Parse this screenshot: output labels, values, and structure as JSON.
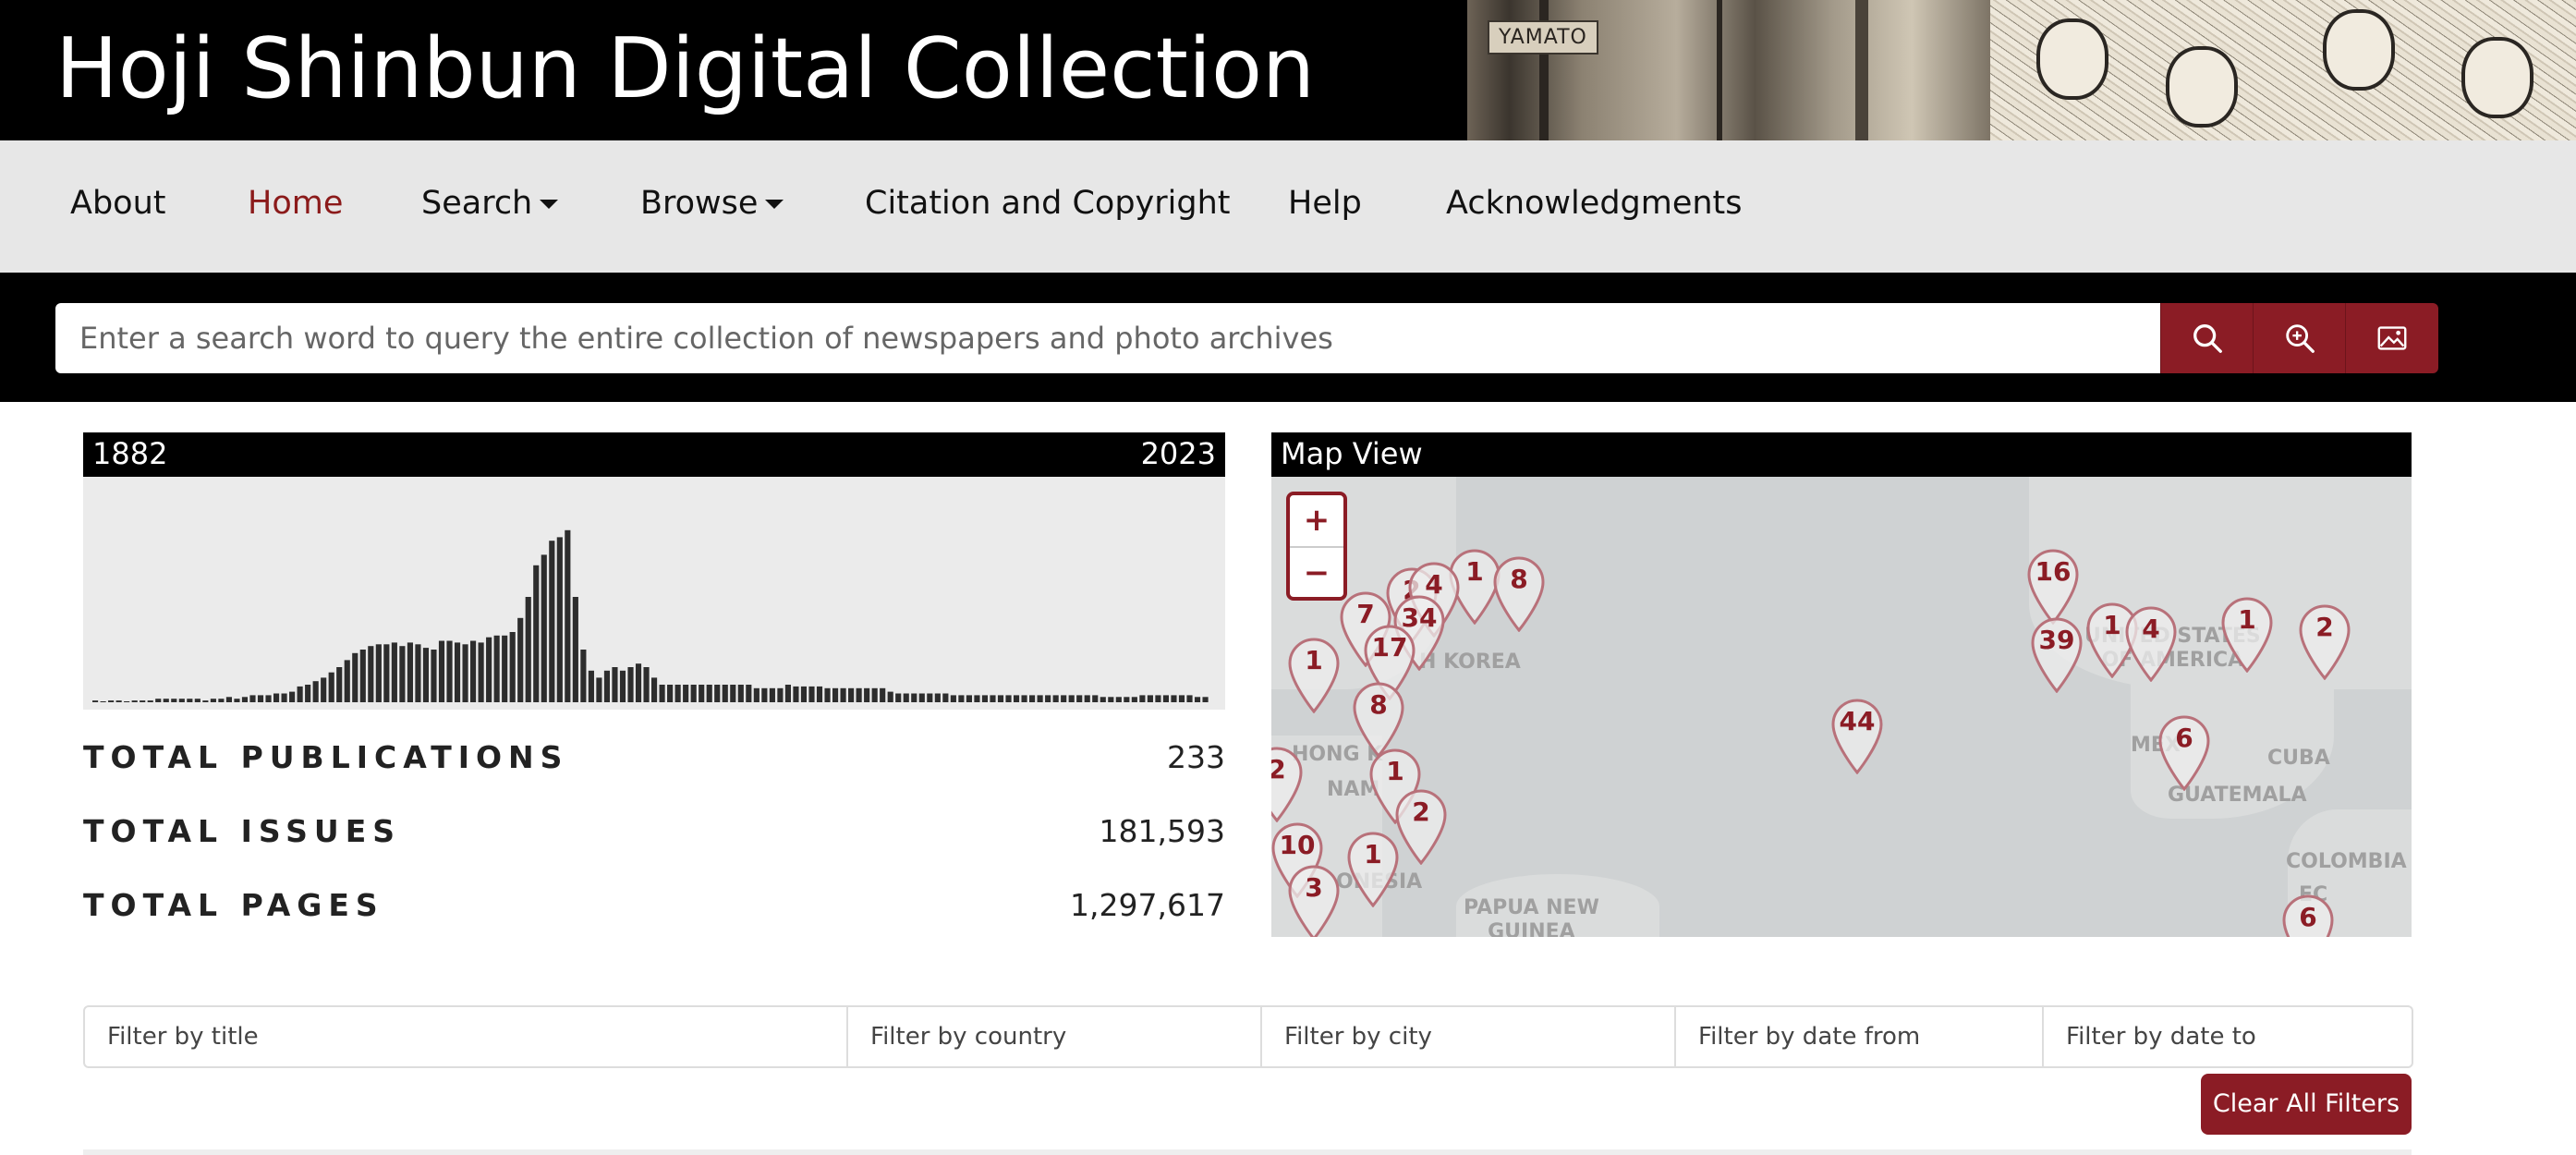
{
  "header": {
    "title": "Hoji Shinbun Digital Collection",
    "banner_sign": "YAMATO"
  },
  "nav": {
    "items": [
      {
        "label": "About"
      },
      {
        "label": "Home",
        "active": true
      },
      {
        "label": "Search",
        "dropdown": true
      },
      {
        "label": "Browse",
        "dropdown": true
      },
      {
        "label": "Citation and Copyright"
      },
      {
        "label": "Help"
      },
      {
        "label": "Acknowledgments"
      }
    ]
  },
  "search": {
    "placeholder": "Enter a search word to query the entire collection of newspapers and photo archives",
    "buttons": [
      "search-icon",
      "zoom-in-search-icon",
      "image-icon"
    ]
  },
  "timeline": {
    "start": "1882",
    "end": "2023",
    "bar_count": 142,
    "histogram_levels": [
      0.01,
      0.0,
      0.01,
      0.01,
      0.0,
      0.01,
      0.01,
      0.01,
      0.02,
      0.02,
      0.02,
      0.02,
      0.02,
      0.02,
      0.01,
      0.02,
      0.02,
      0.03,
      0.02,
      0.03,
      0.04,
      0.04,
      0.04,
      0.05,
      0.05,
      0.06,
      0.09,
      0.1,
      0.12,
      0.14,
      0.17,
      0.2,
      0.24,
      0.28,
      0.3,
      0.32,
      0.33,
      0.33,
      0.34,
      0.32,
      0.34,
      0.33,
      0.31,
      0.3,
      0.35,
      0.35,
      0.34,
      0.33,
      0.35,
      0.34,
      0.37,
      0.38,
      0.38,
      0.4,
      0.48,
      0.6,
      0.78,
      0.84,
      0.92,
      0.94,
      0.98,
      0.6,
      0.3,
      0.18,
      0.14,
      0.18,
      0.2,
      0.18,
      0.2,
      0.22,
      0.2,
      0.14,
      0.1,
      0.1,
      0.1,
      0.1,
      0.1,
      0.1,
      0.1,
      0.1,
      0.1,
      0.1,
      0.1,
      0.1,
      0.08,
      0.08,
      0.08,
      0.08,
      0.1,
      0.09,
      0.09,
      0.09,
      0.09,
      0.08,
      0.08,
      0.08,
      0.08,
      0.08,
      0.08,
      0.08,
      0.08,
      0.06,
      0.05,
      0.05,
      0.05,
      0.05,
      0.05,
      0.05,
      0.05,
      0.04,
      0.04,
      0.04,
      0.04,
      0.04,
      0.04,
      0.04,
      0.04,
      0.04,
      0.04,
      0.04,
      0.04,
      0.04,
      0.04,
      0.04,
      0.04,
      0.04,
      0.04,
      0.04,
      0.03,
      0.03,
      0.03,
      0.03,
      0.03,
      0.04,
      0.04,
      0.04,
      0.04,
      0.04,
      0.04,
      0.04,
      0.03,
      0.03
    ]
  },
  "stats": [
    {
      "label": "TOTAL PUBLICATIONS",
      "value": "233"
    },
    {
      "label": "TOTAL ISSUES",
      "value": "181,593"
    },
    {
      "label": "TOTAL PAGES",
      "value": "1,297,617"
    }
  ],
  "map": {
    "title": "Map View",
    "zoom_in": "+",
    "zoom_out": "−",
    "labels": [
      {
        "text": "UNITED STATES\nOF AMERICA"
      },
      {
        "text": "CUBA"
      },
      {
        "text": "GUATEMALA"
      },
      {
        "text": "COLOMBIA"
      },
      {
        "text": "EC"
      },
      {
        "text": "MEX"
      },
      {
        "text": "H KOREA"
      },
      {
        "text": "HONG K"
      },
      {
        "text": "NAM"
      },
      {
        "text": "ONESIA"
      },
      {
        "text": "PAPUA NEW\nGUINEA"
      }
    ],
    "markers": [
      "1",
      "8",
      "16",
      "2",
      "4",
      "34",
      "7",
      "17",
      "1",
      "8",
      "44",
      "39",
      "1",
      "4",
      "1",
      "2",
      "6",
      "1",
      "2",
      "10",
      "1",
      "3",
      "6",
      "2"
    ]
  },
  "filters": [
    {
      "placeholder": "Filter by title"
    },
    {
      "placeholder": "Filter by country"
    },
    {
      "placeholder": "Filter by city"
    },
    {
      "placeholder": "Filter by date from"
    },
    {
      "placeholder": "Filter by date to"
    }
  ],
  "clear_filters_label": "Clear All Filters"
}
